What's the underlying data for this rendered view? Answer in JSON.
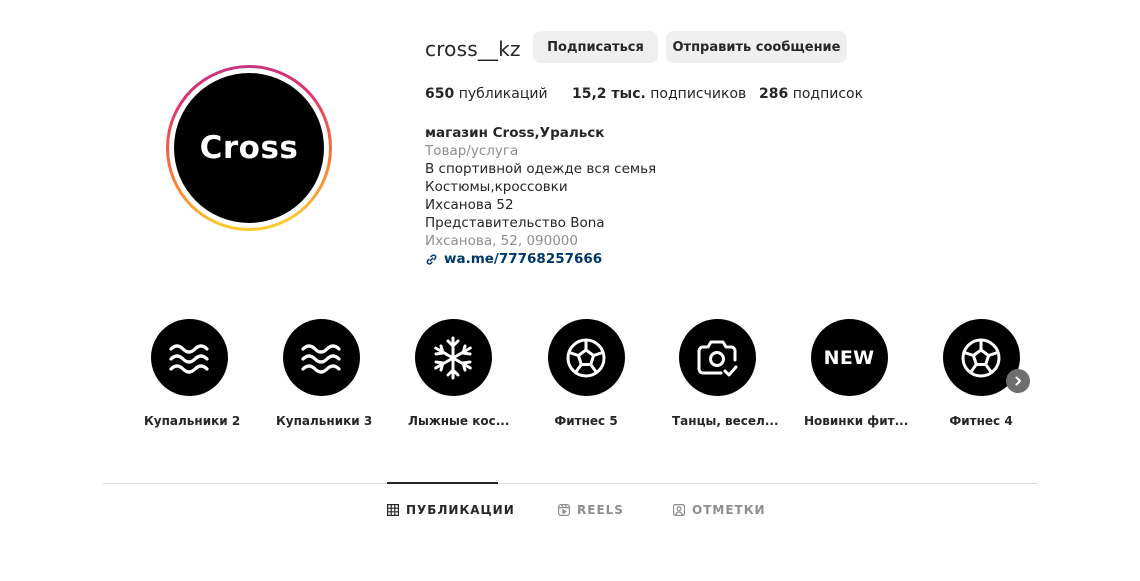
{
  "profile": {
    "username": "cross__kz",
    "avatar_text": "Cross",
    "follow_label": "Подписаться",
    "message_label": "Отправить сообщение"
  },
  "stats": {
    "posts_count": "650",
    "posts_label": "публикаций",
    "followers_count": "15,2 тыс.",
    "followers_label": "подписчиков",
    "following_count": "286",
    "following_label": "подписок"
  },
  "bio": {
    "name": "магазин Cross,Уральск",
    "category": "Товар/услуга",
    "lines": [
      "В спортивной одежде вся семья",
      "Костюмы,кроссовки",
      "Ихсанова 52",
      "Представительство Bona"
    ],
    "address": "Ихсанова, 52, 090000",
    "link": "wa.me/77768257666"
  },
  "highlights": [
    {
      "label": "Купальники 2",
      "icon": "waves-icon"
    },
    {
      "label": "Купальники 3",
      "icon": "waves-icon"
    },
    {
      "label": "Лыжные кос...",
      "icon": "snowflake-icon"
    },
    {
      "label": "Фитнес 5",
      "icon": "soccer-ball-icon"
    },
    {
      "label": "Танцы, весел...",
      "icon": "camera-check-icon"
    },
    {
      "label": "Новинки фит...",
      "icon": "new-badge-icon",
      "text": "NEW"
    },
    {
      "label": "Фитнес 4",
      "icon": "soccer-ball-icon"
    }
  ],
  "tabs": {
    "posts": "ПУБЛИКАЦИИ",
    "reels": "REELS",
    "tagged": "ОТМЕТКИ"
  },
  "colors": {
    "text": "#262626",
    "muted": "#8e8e8e",
    "link": "#00376b",
    "button_bg": "#efefef"
  }
}
